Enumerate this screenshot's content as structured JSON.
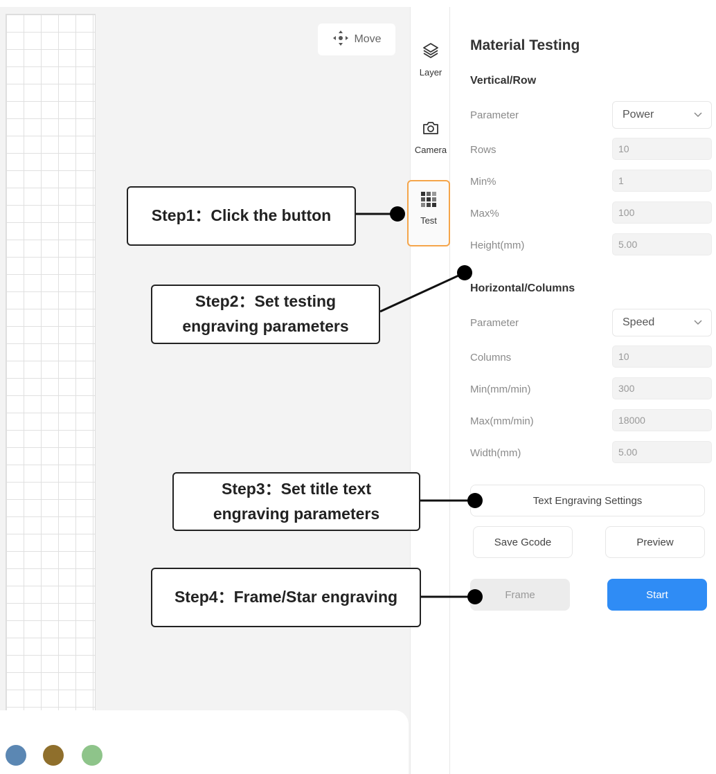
{
  "canvas": {
    "move_label": "Move",
    "colors": [
      "#5b87b3",
      "#8f6f2c",
      "#8ec48a"
    ]
  },
  "toolbar": {
    "layer_label": "Layer",
    "camera_label": "Camera",
    "test_label": "Test"
  },
  "panel": {
    "title": "Material Testing",
    "vertical": {
      "heading": "Vertical/Row",
      "parameter_label": "Parameter",
      "parameter_value": "Power",
      "rows_label": "Rows",
      "rows_value": "10",
      "min_label": "Min%",
      "min_value": "1",
      "max_label": "Max%",
      "max_value": "100",
      "height_label": "Height(mm)",
      "height_value": "5.00"
    },
    "horizontal": {
      "heading": "Horizontal/Columns",
      "parameter_label": "Parameter",
      "parameter_value": "Speed",
      "columns_label": "Columns",
      "columns_value": "10",
      "min_label": "Min(mm/min)",
      "min_value": "300",
      "max_label": "Max(mm/min)",
      "max_value": "18000",
      "width_label": "Width(mm)",
      "width_value": "5.00"
    },
    "buttons": {
      "text_engraving": "Text Engraving Settings",
      "save_gcode": "Save Gcode",
      "preview": "Preview",
      "frame": "Frame",
      "start": "Start"
    },
    "accent": "#2f8cf5"
  },
  "annotations": {
    "step1": "Step1：Click the button",
    "step2_line1": "Step2：Set testing",
    "step2_line2": "engraving parameters",
    "step3_line1": "Step3：Set title text",
    "step3_line2": "engraving parameters",
    "step4": "Step4：Frame/Star engraving"
  }
}
